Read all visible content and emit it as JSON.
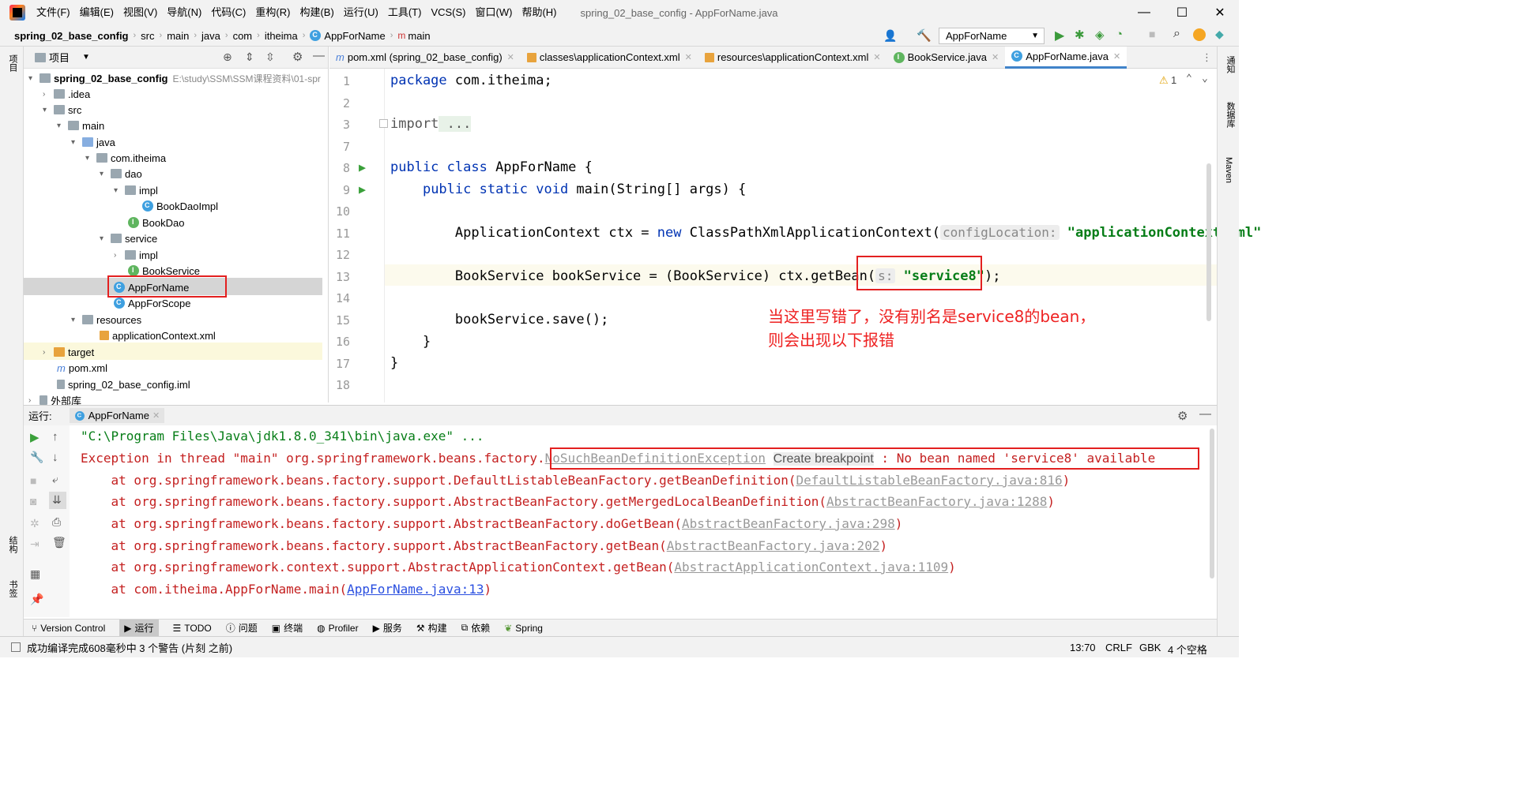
{
  "menu": [
    "文件(F)",
    "编辑(E)",
    "视图(V)",
    "导航(N)",
    "代码(C)",
    "重构(R)",
    "构建(B)",
    "运行(U)",
    "工具(T)",
    "VCS(S)",
    "窗口(W)",
    "帮助(H)"
  ],
  "window_title": "spring_02_base_config - AppForName.java",
  "breadcrumb": [
    "spring_02_base_config",
    "src",
    "main",
    "java",
    "com",
    "itheima",
    "AppForName",
    "main"
  ],
  "run_config": "AppForName",
  "left_strip": [
    "项目",
    "结构",
    "书签"
  ],
  "right_strip": [
    "通知",
    "数据库",
    "Maven"
  ],
  "project": {
    "header": "项目",
    "root": "spring_02_base_config",
    "root_path": "E:\\study\\SSM\\SSM课程资料\\01-spr",
    "items": [
      ".idea",
      "src",
      "main",
      "java",
      "com.itheima",
      "dao",
      "impl",
      "BookDaoImpl",
      "BookDao",
      "service",
      "impl",
      "BookService",
      "AppForName",
      "AppForScope",
      "resources",
      "applicationContext.xml",
      "target",
      "pom.xml",
      "spring_02_base_config.iml",
      "外部库"
    ]
  },
  "tabs": [
    "pom.xml (spring_02_base_config)",
    "classes\\applicationContext.xml",
    "resources\\applicationContext.xml",
    "BookService.java",
    "AppForName.java"
  ],
  "warnings": "1",
  "line_numbers": [
    "1",
    "2",
    "3",
    "7",
    "8",
    "9",
    "10",
    "11",
    "12",
    "13",
    "14",
    "15",
    "16",
    "17",
    "18"
  ],
  "code": {
    "l1_kw": "package",
    "l1": " com.itheima;",
    "l3_kw": "import",
    "l3": " ...",
    "l8_kw": "public class",
    "l8": " AppForName {",
    "l9_kw": "public static void",
    "l9": " main(String[] args) {",
    "l11a": "ApplicationContext ctx = ",
    "l11_kw": "new",
    "l11b": " ClassPathXmlApplicationContext(",
    "l11_hint": "configLocation:",
    "l11_str": "\"applicationContext.xml\"",
    "l13a": "BookService bookService = (BookService) ctx.getBean(",
    "l13_hint": "s:",
    "l13_str": "\"service8\"",
    "l13b": ");",
    "l15": "bookService.save();",
    "l16": "}",
    "l17": "}"
  },
  "annotation": [
    "当这里写错了，没有别名是service8的bean，",
    "则会出现以下报错"
  ],
  "run": {
    "label": "运行:",
    "tab": "AppForName",
    "lines": {
      "cmd": "\"C:\\Program Files\\Java\\jdk1.8.0_341\\bin\\java.exe\" ...",
      "exc_a": "Exception in thread \"main\" org.springframework.beans.factory.",
      "exc_link": "NoSuchBeanDefinitionException",
      "exc_hint": "Create breakpoint",
      "exc_b": " : No bean named 'service8' available",
      "s1a": "    at org.springframework.beans.factory.support.DefaultListableBeanFactory.getBeanDefinition(",
      "s1l": "DefaultListableBeanFactory.java:816",
      "s1b": ")",
      "s2a": "    at org.springframework.beans.factory.support.AbstractBeanFactory.getMergedLocalBeanDefinition(",
      "s2l": "AbstractBeanFactory.java:1288",
      "s2b": ")",
      "s3a": "    at org.springframework.beans.factory.support.AbstractBeanFactory.doGetBean(",
      "s3l": "AbstractBeanFactory.java:298",
      "s3b": ")",
      "s4a": "    at org.springframework.beans.factory.support.AbstractBeanFactory.getBean(",
      "s4l": "AbstractBeanFactory.java:202",
      "s4b": ")",
      "s5a": "    at org.springframework.context.support.AbstractApplicationContext.getBean(",
      "s5l": "AbstractApplicationContext.java:1109",
      "s5b": ")",
      "s6a": "    at com.itheima.AppForName.main(",
      "s6l": "AppForName.java:13",
      "s6b": ")"
    }
  },
  "bottom_tools": [
    "Version Control",
    "运行",
    "TODO",
    "问题",
    "终端",
    "Profiler",
    "服务",
    "构建",
    "依赖",
    "Spring"
  ],
  "status": {
    "message": "成功编译完成608毫秒中 3 个警告 (片刻 之前)",
    "position": "13:70",
    "line_sep": "CRLF",
    "encoding": "GBK",
    "indent": "4 个空格"
  }
}
